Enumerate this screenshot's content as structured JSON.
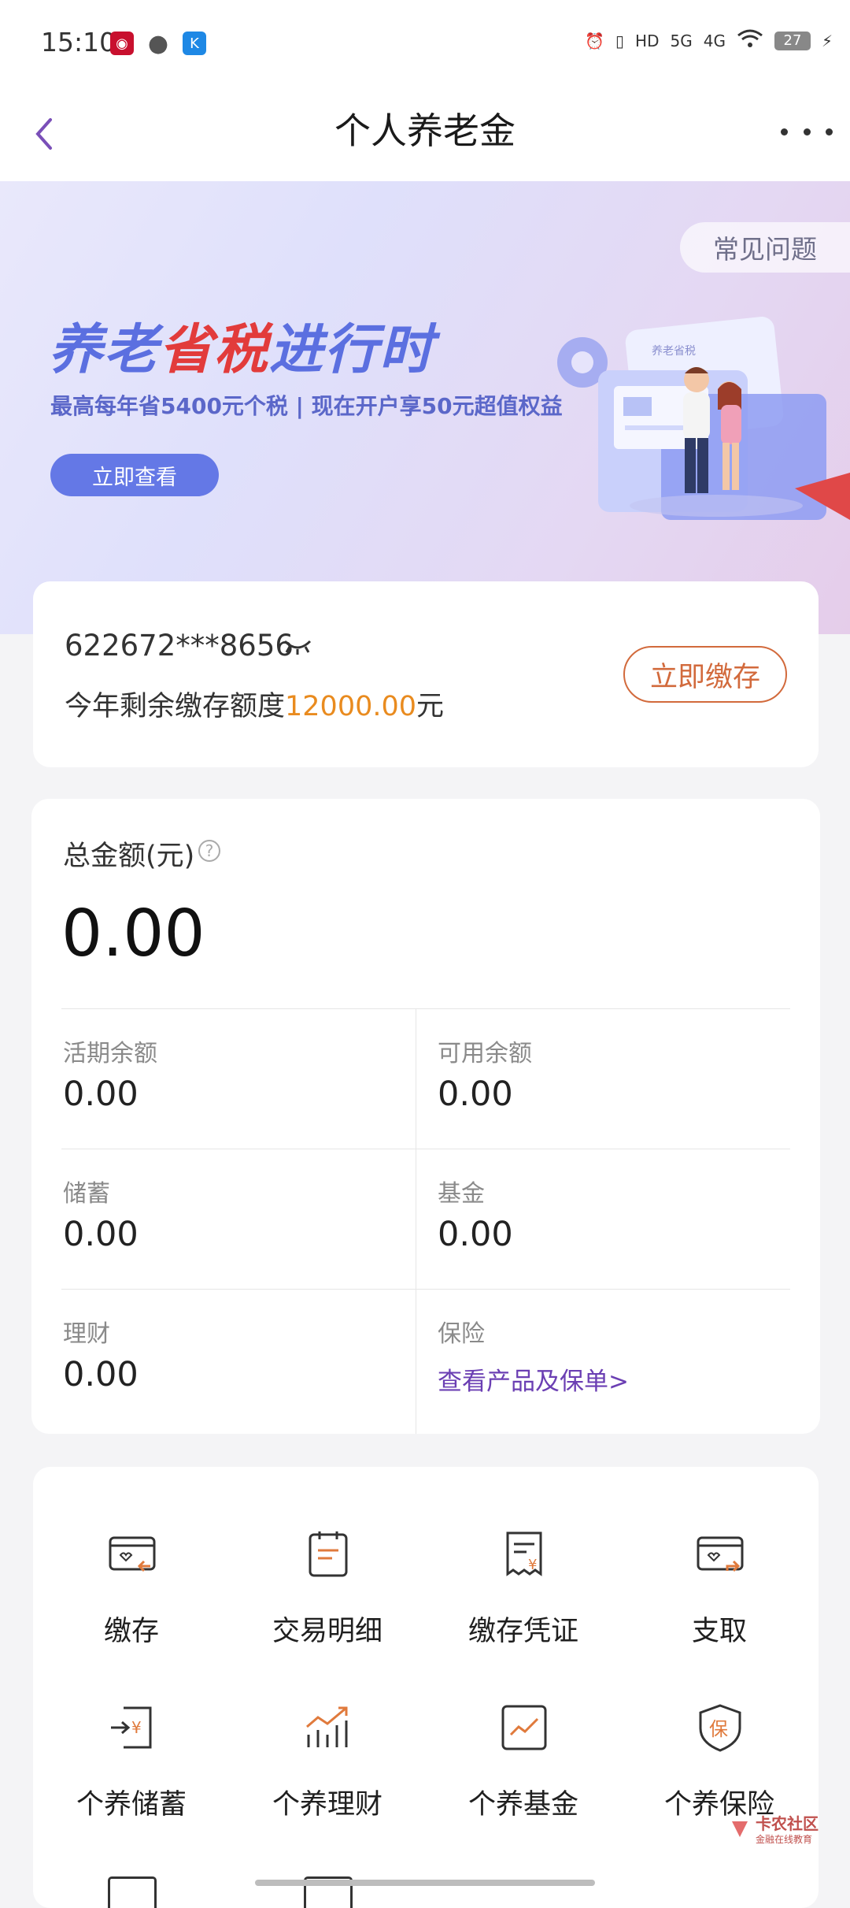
{
  "status_bar": {
    "time": "15:10",
    "network_labels": [
      "HD",
      "5G",
      "4G"
    ],
    "battery": "27"
  },
  "header": {
    "title": "个人养老金"
  },
  "banner": {
    "faq_label": "常见问题",
    "headline_part1": "养老",
    "headline_part2": "省税",
    "headline_part3": "进行时",
    "subtitle": "最高每年省5400元个税 | 现在开户享50元超值权益",
    "button_label": "立即查看",
    "illustration_tag": "养老省税"
  },
  "account": {
    "number": "622672***8656",
    "quota_prefix": "今年剩余缴存额度",
    "quota_value": "12000.00",
    "quota_suffix": "元",
    "deposit_button": "立即缴存"
  },
  "balance": {
    "total_label": "总金额(元)",
    "help_glyph": "?",
    "total_value": "0.00",
    "cells": [
      {
        "label": "活期余额",
        "value": "0.00"
      },
      {
        "label": "可用余额",
        "value": "0.00"
      },
      {
        "label": "储蓄",
        "value": "0.00"
      },
      {
        "label": "基金",
        "value": "0.00"
      },
      {
        "label": "理财",
        "value": "0.00"
      },
      {
        "label": "保险",
        "link": "查看产品及保单>"
      }
    ]
  },
  "services": {
    "items": [
      {
        "label": "缴存",
        "icon": "card-deposit-icon"
      },
      {
        "label": "交易明细",
        "icon": "clipboard-icon"
      },
      {
        "label": "缴存凭证",
        "icon": "receipt-icon"
      },
      {
        "label": "支取",
        "icon": "card-withdraw-icon"
      },
      {
        "label": "个养储蓄",
        "icon": "savings-icon"
      },
      {
        "label": "个养理财",
        "icon": "growth-chart-icon"
      },
      {
        "label": "个养基金",
        "icon": "fund-chart-icon"
      },
      {
        "label": "个养保险",
        "icon": "shield-icon"
      }
    ]
  },
  "watermark": {
    "title": "卡农社区",
    "subtitle": "金融在线教育"
  },
  "colors": {
    "accent_orange": "#e98b1f",
    "deposit_red": "#d26a3c",
    "link_purple": "#6b3fb3",
    "banner_blue": "#6478e6",
    "headline_red": "#e23b3b"
  }
}
